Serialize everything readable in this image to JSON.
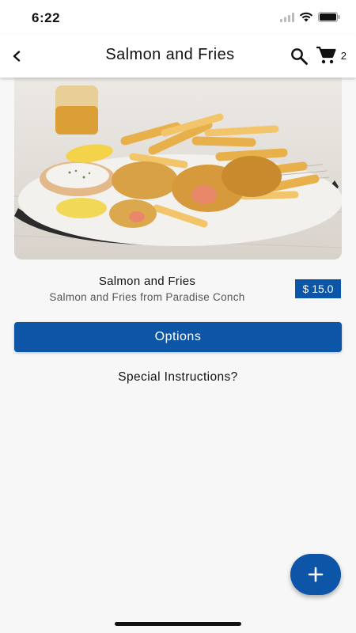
{
  "status_bar": {
    "time": "6:22",
    "icons": [
      "signal-icon",
      "wifi-icon",
      "battery-icon"
    ]
  },
  "app_bar": {
    "back_icon": "chevron-left-icon",
    "title": "Salmon and Fries",
    "search_icon": "search-icon",
    "cart_icon": "cart-icon",
    "cart_count": "2"
  },
  "item": {
    "image": "salmon-and-fries-photo",
    "name": "Salmon and Fries",
    "description": "Salmon and Fries from Paradise Conch",
    "price": "$ 15.0"
  },
  "options_button": {
    "label": "Options"
  },
  "special_instructions": {
    "label": "Special Instructions?"
  },
  "fab": {
    "icon": "plus-icon"
  },
  "colors": {
    "primary": "#0d55a7",
    "background": "#f7f7f7",
    "app_bar": "#ffffff"
  }
}
